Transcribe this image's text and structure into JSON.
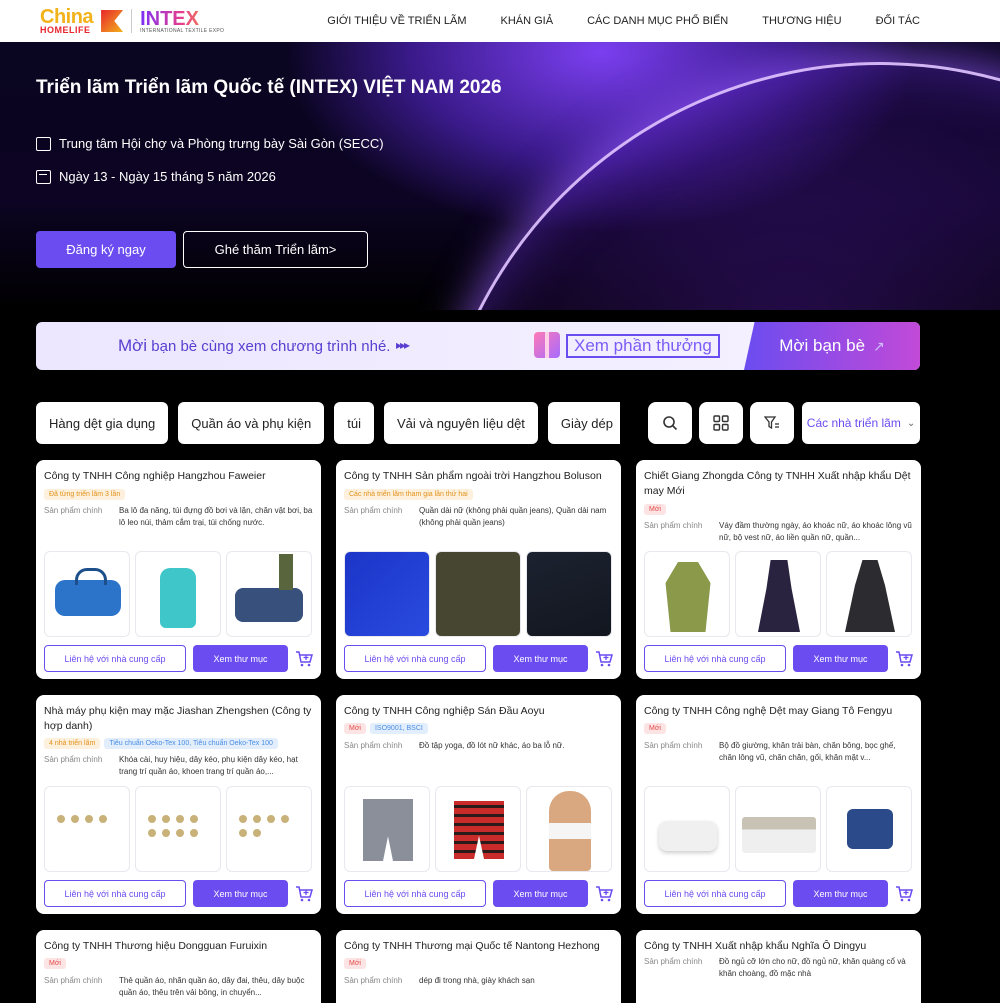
{
  "header": {
    "logo_china": "China",
    "logo_homelife": "HOMELIFE",
    "logo_intex": "INTEX",
    "logo_intex_sub": "INTERNATIONAL TEXTILE EXPO",
    "nav": [
      "GIỚI THIỆU VỀ TRIỂN LÃM",
      "KHÁN GIẢ",
      "CÁC DANH MỤC PHỔ BIẾN",
      "THƯƠNG HIỆU",
      "ĐỐI TÁC"
    ]
  },
  "hero": {
    "title": "Triển lãm Triển lãm Quốc tế (INTEX) VIỆT NAM 2026",
    "venue": "Trung tâm Hội chợ và Phòng trưng bày Sài Gòn (SECC)",
    "date": "Ngày 13 - Ngày 15 tháng 5 năm 2026",
    "register_label": "Đăng ký ngay",
    "visit_label": "Ghé thăm Triển lãm>"
  },
  "invite": {
    "text_lead": "Mời",
    "text_rest": " bạn bè cùng xem chương trình nhé.",
    "arrows": "▸▸▸",
    "reward_label": "Xem phần thưởng",
    "invite_label": "Mời bạn bè"
  },
  "filters": {
    "chips": [
      "Hàng dệt gia dụng",
      "Quần áo và phụ kiện",
      "túi",
      "Vải và nguyên liệu dệt",
      "Giày dép"
    ],
    "exhibitor_select": "Các nhà triển lãm"
  },
  "labels": {
    "main_products": "Sản phẩm chính",
    "contact": "Liên hệ với nhà cung cấp",
    "view": "Xem thư mục"
  },
  "cards": [
    {
      "name": "Công ty TNHH Công nghiệp Hangzhou Faweier",
      "tags": [
        {
          "text": "Đã từng triển lãm 3 lần",
          "color": "orange"
        }
      ],
      "products": "Ba lô đa năng, túi đựng đồ bơi và lặn, chăn vật bơi, ba lô leo núi, thảm cắm trại, túi chống nước."
    },
    {
      "name": "Công ty TNHH Sản phẩm ngoài trời Hangzhou Boluson",
      "tags": [
        {
          "text": "Các nhà triển lãm tham gia lần thứ hai",
          "color": "orange"
        }
      ],
      "products": "Quần dài nữ (không phải quần jeans), Quần dài nam (không phải quần jeans)"
    },
    {
      "name": "Chiết Giang Zhongda Công ty TNHH Xuất nhập khẩu Dệt may Mới",
      "tags": [
        {
          "text": "Mới",
          "color": "red"
        }
      ],
      "products": "Váy đầm thường ngày, áo khoác nữ, áo khoác lông vũ nữ, bộ vest nữ, áo liền quần nữ, quần..."
    },
    {
      "name": "Nhà máy phụ kiện may mặc Jiashan Zhengshen (Công ty hợp danh)",
      "tags": [
        {
          "text": "4 nhà triển lãm",
          "color": "orange"
        },
        {
          "text": "Tiêu chuẩn Oeko-Tex 100, Tiêu chuẩn Oeko-Tex 100",
          "color": "blue"
        }
      ],
      "products": "Khóa cài, huy hiệu, dây kéo, phụ kiện dây kéo, hạt trang trí quần áo, khoen trang trí quần áo,..."
    },
    {
      "name": "Công ty TNHH Công nghiệp Sán Đầu Aoyu",
      "tags": [
        {
          "text": "Mới",
          "color": "red"
        },
        {
          "text": "ISO9001, BSCI",
          "color": "blue"
        }
      ],
      "products": "Đồ tập yoga, đồ lót nữ khác, áo ba lỗ nữ."
    },
    {
      "name": "Công ty TNHH Công nghệ Dệt may Giang Tô Fengyu",
      "tags": [
        {
          "text": "Mới",
          "color": "red"
        }
      ],
      "products": "Bộ đồ giường, khăn trải bàn, chăn bông, bọc ghế, chăn lông vũ, chăn chăn, gối, khăn mặt v..."
    },
    {
      "name": "Công ty TNHH Thương hiệu Dongguan Furuixin",
      "tags": [
        {
          "text": "Mới",
          "color": "red"
        }
      ],
      "products": "Thẻ quần áo, nhãn quần áo, dây đai, thêu, dây buộc quần áo, thêu trên vải bông, in chuyển..."
    },
    {
      "name": "Công ty TNHH Thương mại Quốc tế Nantong Hezhong",
      "tags": [
        {
          "text": "Mới",
          "color": "red"
        }
      ],
      "products": "dép đi trong nhà, giày khách sạn"
    },
    {
      "name": "Công ty TNHH Xuất nhập khẩu Nghĩa Ô Dingyu",
      "tags": [],
      "products": "Đồ ngủ cỡ lớn cho nữ, đồ ngủ nữ, khăn quàng cổ và khăn choàng, đồ mặc nhà"
    }
  ]
}
